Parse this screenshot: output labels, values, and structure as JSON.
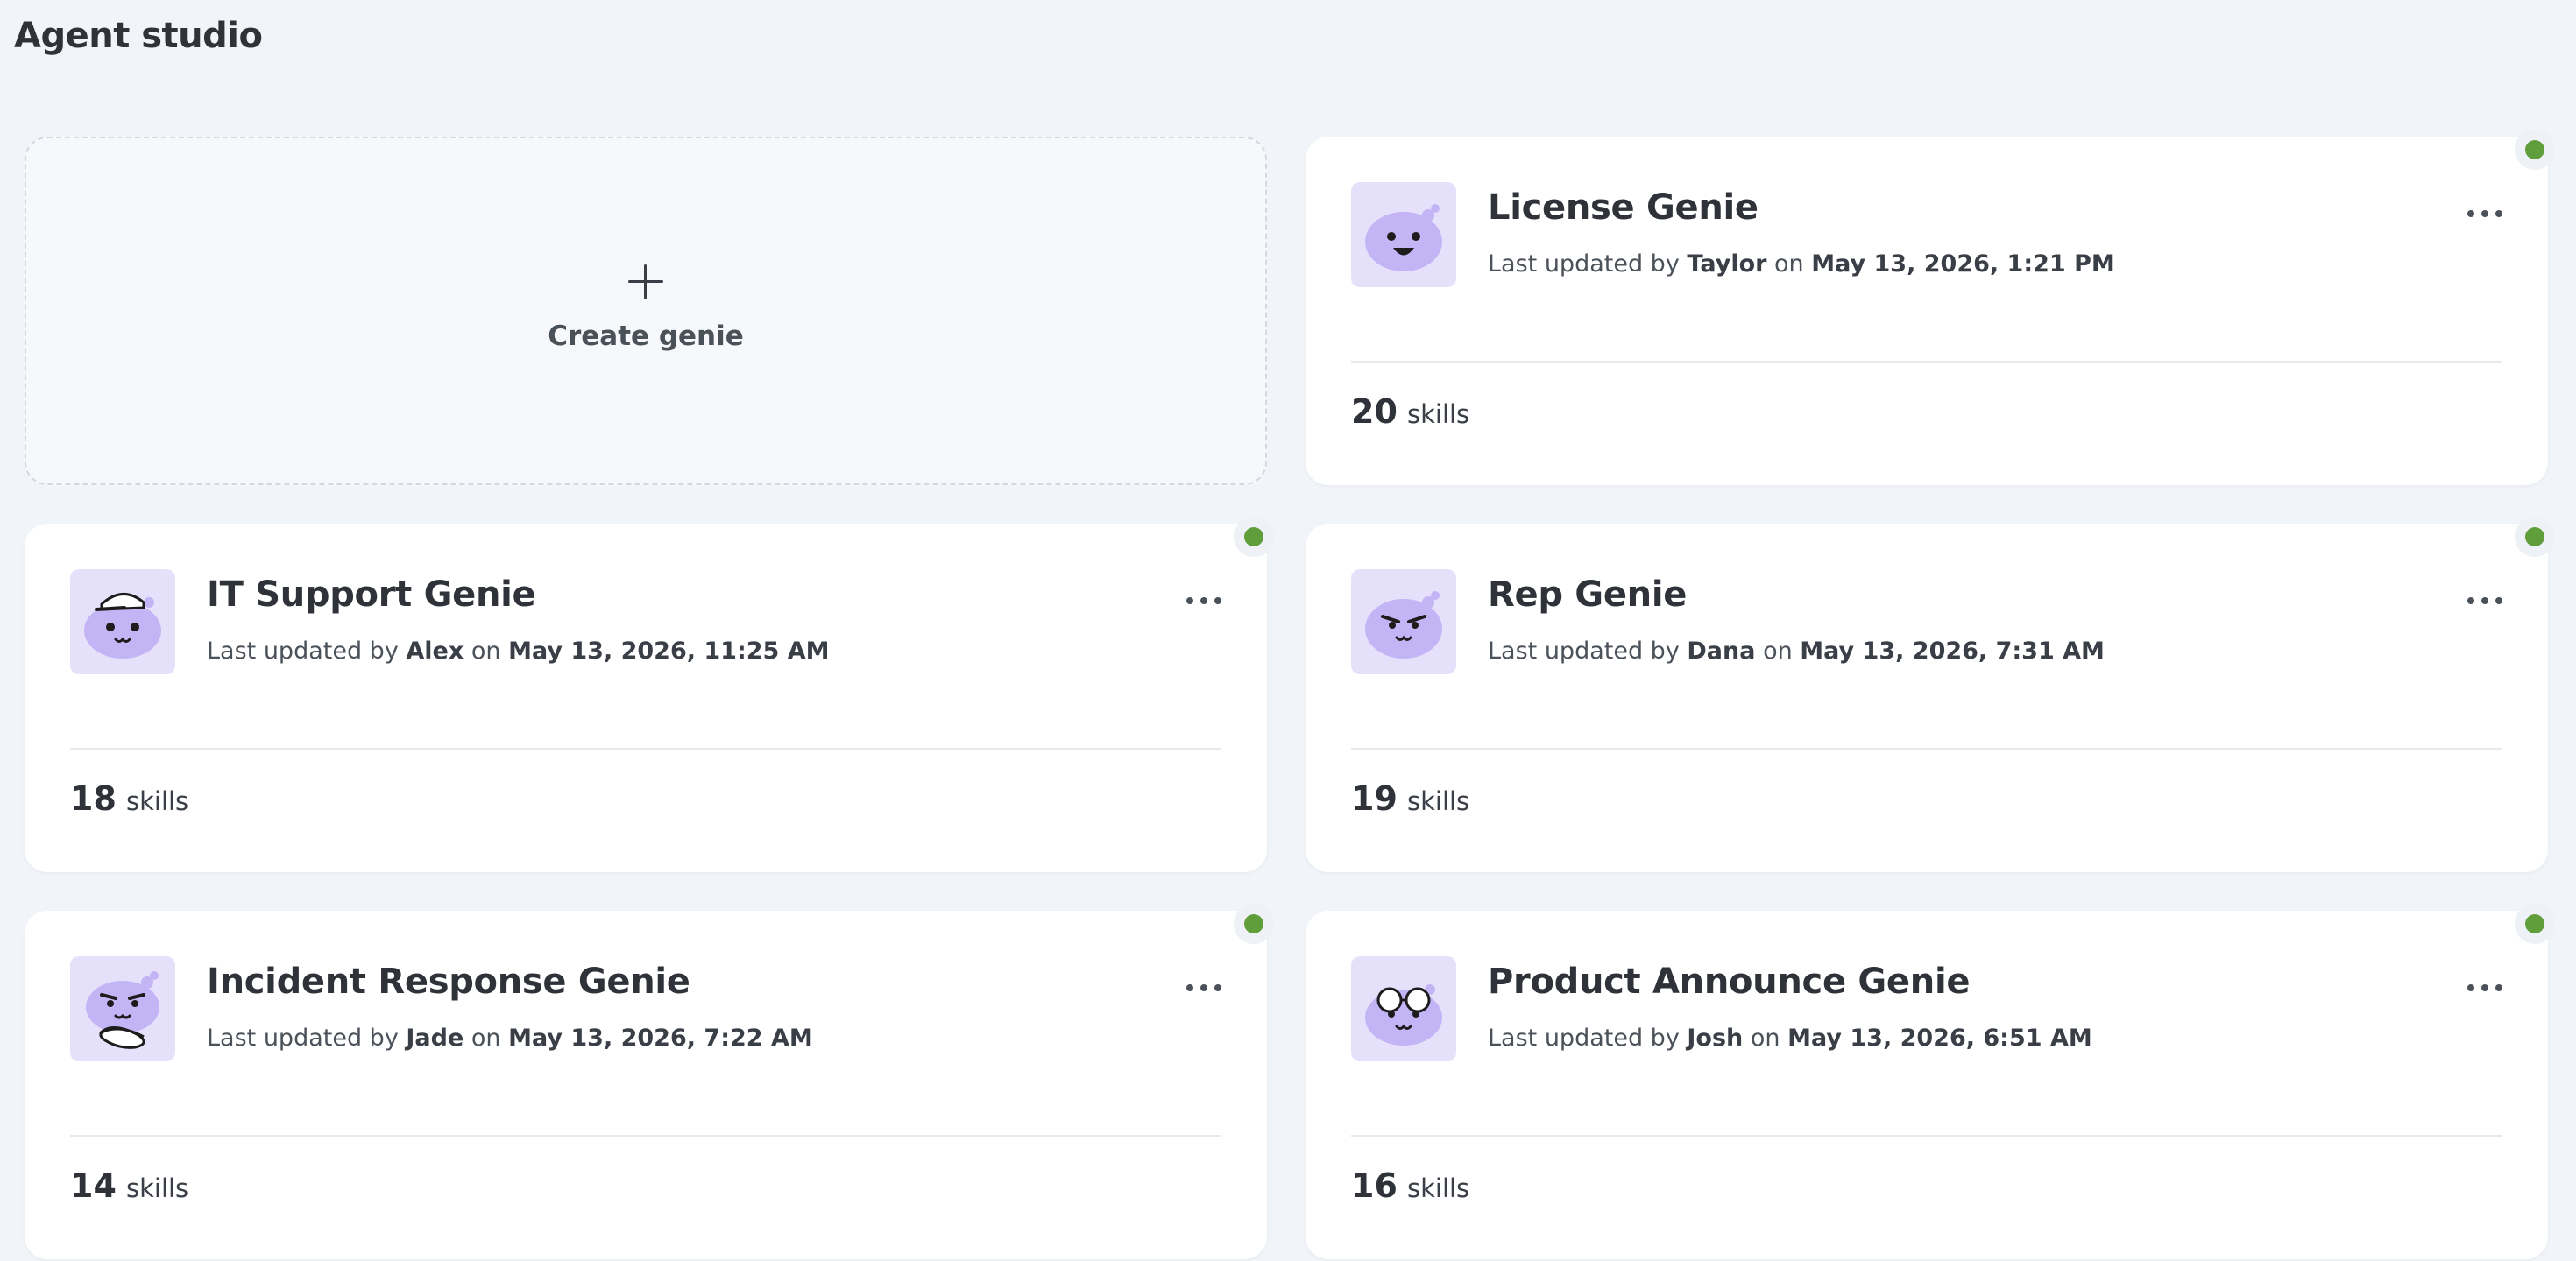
{
  "page": {
    "title": "Agent studio"
  },
  "create": {
    "label": "Create genie"
  },
  "labels": {
    "updated_prefix": "Last updated by",
    "on": "on",
    "skills_suffix": "skills"
  },
  "colors": {
    "status_active": "#5f9e3b",
    "avatar_bg": "#e6e1fb",
    "avatar_face": "#c3b4f5"
  },
  "genies": [
    {
      "name": "License Genie",
      "updated_by": "Taylor",
      "updated_at": "May 13, 2026, 1:21 PM",
      "skills": "20",
      "status": "active",
      "avatar": "smiling-genie-avatar"
    },
    {
      "name": "IT Support Genie",
      "updated_by": "Alex",
      "updated_at": "May 13, 2026, 11:25 AM",
      "skills": "18",
      "status": "active",
      "avatar": "cap-genie-avatar"
    },
    {
      "name": "Rep Genie",
      "updated_by": "Dana",
      "updated_at": "May 13, 2026, 7:31 AM",
      "skills": "19",
      "status": "active",
      "avatar": "smirking-genie-avatar"
    },
    {
      "name": "Incident Response Genie",
      "updated_by": "Jade",
      "updated_at": "May 13, 2026, 7:22 AM",
      "skills": "14",
      "status": "active",
      "avatar": "arms-crossed-genie-avatar"
    },
    {
      "name": "Product Announce Genie",
      "updated_by": "Josh",
      "updated_at": "May 13, 2026, 6:51 AM",
      "skills": "16",
      "status": "active",
      "avatar": "glasses-genie-avatar"
    }
  ]
}
